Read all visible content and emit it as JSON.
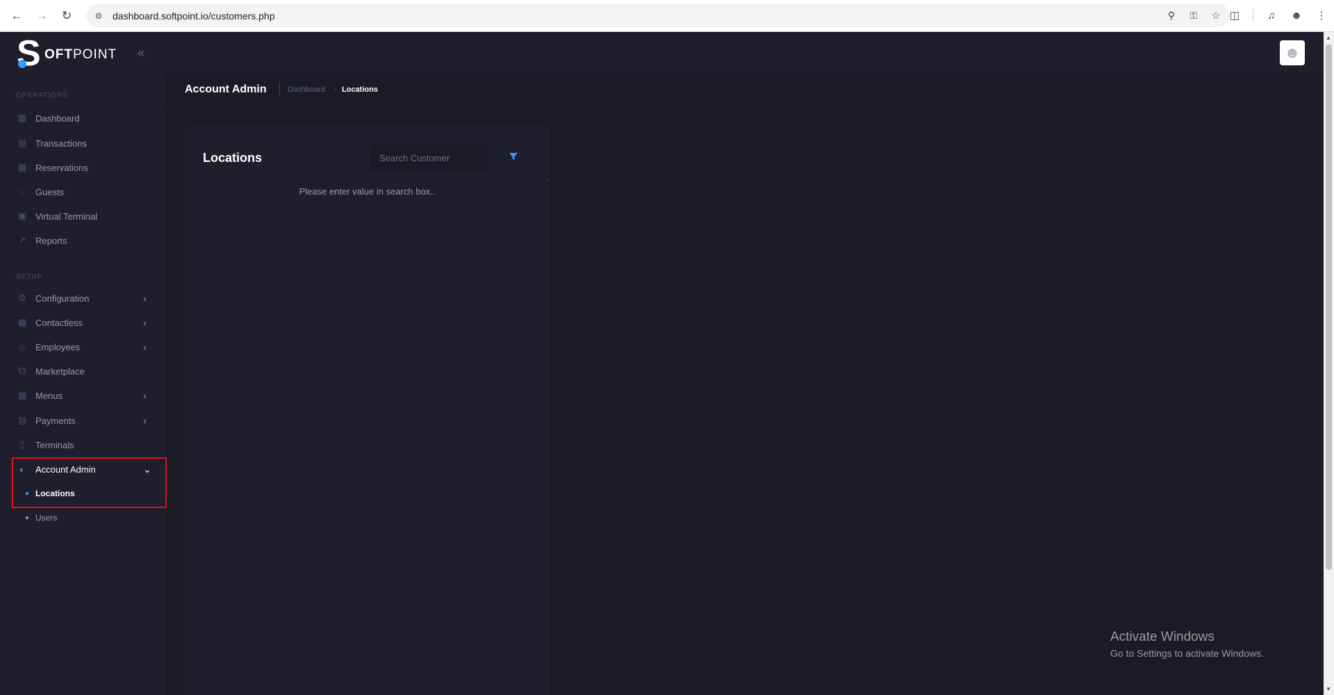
{
  "browser": {
    "url": "dashboard.softpoint.io/customers.php"
  },
  "brand": {
    "letter": "S",
    "name_bold": "OFT",
    "name_rest": "POINT",
    "accent_color": "#3699ff"
  },
  "sidebar": {
    "operations_label": "OPERATIONS",
    "setup_label": "SETUP",
    "operations": [
      {
        "label": "Dashboard",
        "icon": "dashboard-icon"
      },
      {
        "label": "Transactions",
        "icon": "transactions-icon"
      },
      {
        "label": "Reservations",
        "icon": "calendar-icon"
      },
      {
        "label": "Guests",
        "icon": "heart-icon"
      },
      {
        "label": "Virtual Terminal",
        "icon": "calculator-icon"
      },
      {
        "label": "Reports",
        "icon": "chart-icon"
      }
    ],
    "setup": [
      {
        "label": "Configuration",
        "icon": "gear-icon"
      },
      {
        "label": "Contactless",
        "icon": "qr-icon"
      },
      {
        "label": "Employees",
        "icon": "users-icon"
      },
      {
        "label": "Marketplace",
        "icon": "cart-icon"
      },
      {
        "label": "Menus",
        "icon": "grid-icon"
      },
      {
        "label": "Payments",
        "icon": "card-icon"
      },
      {
        "label": "Terminals",
        "icon": "tablet-icon"
      },
      {
        "label": "Account Admin",
        "icon": "account-icon"
      }
    ],
    "account_admin_sub": [
      {
        "label": "Locations"
      },
      {
        "label": "Users"
      }
    ]
  },
  "subheader": {
    "title": "Account Admin",
    "breadcrumb": [
      "Dashboard",
      "Locations"
    ],
    "crumb_separator": "-"
  },
  "card": {
    "title": "Locations",
    "search_placeholder": "Search Customer",
    "empty_message": "Please enter value in search box.."
  },
  "watermark": {
    "line1": "Activate Windows",
    "line2": "Go to Settings to activate Windows."
  }
}
